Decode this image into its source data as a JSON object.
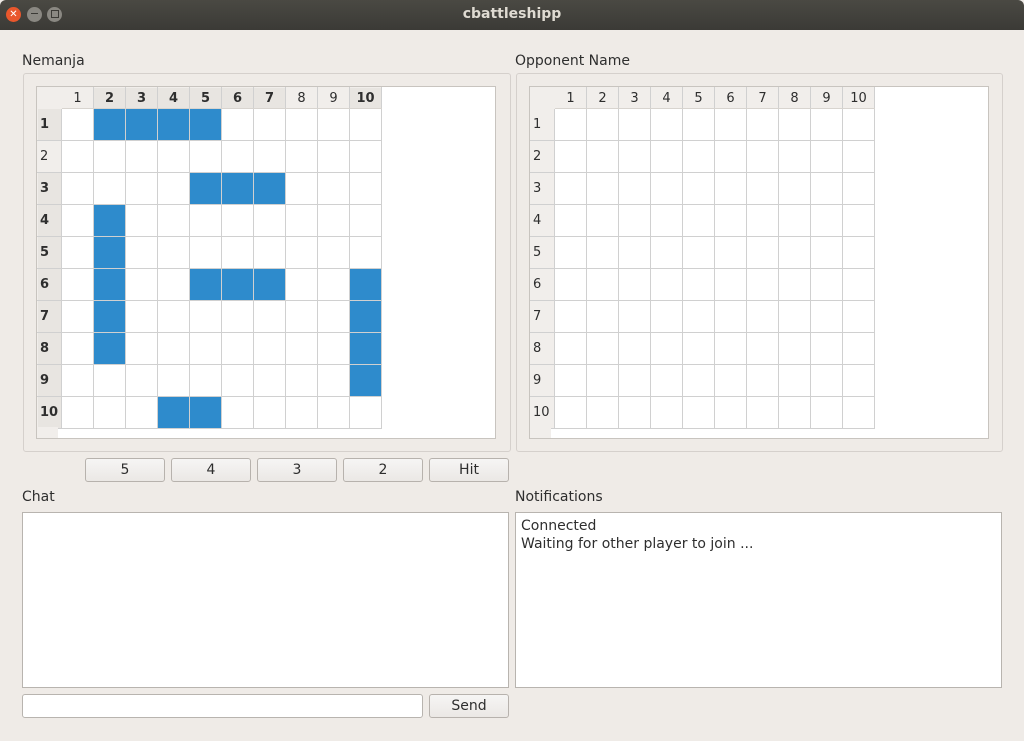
{
  "window": {
    "title": "cbattleshipp"
  },
  "player": {
    "name": "Nemanja",
    "columns": [
      "1",
      "2",
      "3",
      "4",
      "5",
      "6",
      "7",
      "8",
      "9",
      "10"
    ],
    "rows": [
      "1",
      "2",
      "3",
      "4",
      "5",
      "6",
      "7",
      "8",
      "9",
      "10"
    ],
    "bold_columns": [
      "2",
      "3",
      "4",
      "5",
      "6",
      "7",
      "10"
    ],
    "bold_rows": [
      "1",
      "3",
      "4",
      "5",
      "6",
      "7",
      "8",
      "9",
      "10"
    ],
    "ships": [
      [
        1,
        2
      ],
      [
        1,
        3
      ],
      [
        1,
        4
      ],
      [
        1,
        5
      ],
      [
        3,
        5
      ],
      [
        3,
        6
      ],
      [
        3,
        7
      ],
      [
        4,
        2
      ],
      [
        5,
        2
      ],
      [
        6,
        2
      ],
      [
        7,
        2
      ],
      [
        8,
        2
      ],
      [
        6,
        5
      ],
      [
        6,
        6
      ],
      [
        6,
        7
      ],
      [
        6,
        10
      ],
      [
        7,
        10
      ],
      [
        8,
        10
      ],
      [
        9,
        10
      ],
      [
        10,
        4
      ],
      [
        10,
        5
      ]
    ],
    "ship_color": "#2e8bcc"
  },
  "opponent": {
    "name": "Opponent Name",
    "columns": [
      "1",
      "2",
      "3",
      "4",
      "5",
      "6",
      "7",
      "8",
      "9",
      "10"
    ],
    "rows": [
      "1",
      "2",
      "3",
      "4",
      "5",
      "6",
      "7",
      "8",
      "9",
      "10"
    ]
  },
  "ship_buttons": [
    {
      "label": "5"
    },
    {
      "label": "4"
    },
    {
      "label": "3"
    },
    {
      "label": "2"
    },
    {
      "label": "Hit"
    }
  ],
  "chat": {
    "label": "Chat",
    "input_value": "",
    "send_label": "Send"
  },
  "notifications": {
    "label": "Notifications",
    "lines": [
      "Connected",
      "Waiting for other player to join ..."
    ]
  }
}
